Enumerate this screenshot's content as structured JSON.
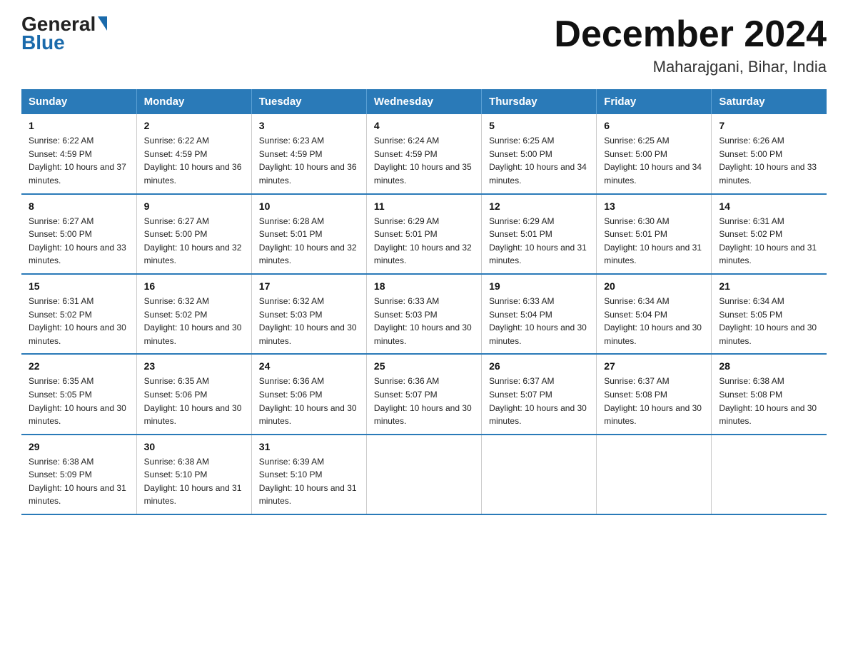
{
  "header": {
    "logo_general": "General",
    "logo_blue": "Blue",
    "month_title": "December 2024",
    "location": "Maharajgani, Bihar, India"
  },
  "days_of_week": [
    "Sunday",
    "Monday",
    "Tuesday",
    "Wednesday",
    "Thursday",
    "Friday",
    "Saturday"
  ],
  "weeks": [
    [
      {
        "day": "1",
        "sunrise": "6:22 AM",
        "sunset": "4:59 PM",
        "daylight": "10 hours and 37 minutes."
      },
      {
        "day": "2",
        "sunrise": "6:22 AM",
        "sunset": "4:59 PM",
        "daylight": "10 hours and 36 minutes."
      },
      {
        "day": "3",
        "sunrise": "6:23 AM",
        "sunset": "4:59 PM",
        "daylight": "10 hours and 36 minutes."
      },
      {
        "day": "4",
        "sunrise": "6:24 AM",
        "sunset": "4:59 PM",
        "daylight": "10 hours and 35 minutes."
      },
      {
        "day": "5",
        "sunrise": "6:25 AM",
        "sunset": "5:00 PM",
        "daylight": "10 hours and 34 minutes."
      },
      {
        "day": "6",
        "sunrise": "6:25 AM",
        "sunset": "5:00 PM",
        "daylight": "10 hours and 34 minutes."
      },
      {
        "day": "7",
        "sunrise": "6:26 AM",
        "sunset": "5:00 PM",
        "daylight": "10 hours and 33 minutes."
      }
    ],
    [
      {
        "day": "8",
        "sunrise": "6:27 AM",
        "sunset": "5:00 PM",
        "daylight": "10 hours and 33 minutes."
      },
      {
        "day": "9",
        "sunrise": "6:27 AM",
        "sunset": "5:00 PM",
        "daylight": "10 hours and 32 minutes."
      },
      {
        "day": "10",
        "sunrise": "6:28 AM",
        "sunset": "5:01 PM",
        "daylight": "10 hours and 32 minutes."
      },
      {
        "day": "11",
        "sunrise": "6:29 AM",
        "sunset": "5:01 PM",
        "daylight": "10 hours and 32 minutes."
      },
      {
        "day": "12",
        "sunrise": "6:29 AM",
        "sunset": "5:01 PM",
        "daylight": "10 hours and 31 minutes."
      },
      {
        "day": "13",
        "sunrise": "6:30 AM",
        "sunset": "5:01 PM",
        "daylight": "10 hours and 31 minutes."
      },
      {
        "day": "14",
        "sunrise": "6:31 AM",
        "sunset": "5:02 PM",
        "daylight": "10 hours and 31 minutes."
      }
    ],
    [
      {
        "day": "15",
        "sunrise": "6:31 AM",
        "sunset": "5:02 PM",
        "daylight": "10 hours and 30 minutes."
      },
      {
        "day": "16",
        "sunrise": "6:32 AM",
        "sunset": "5:02 PM",
        "daylight": "10 hours and 30 minutes."
      },
      {
        "day": "17",
        "sunrise": "6:32 AM",
        "sunset": "5:03 PM",
        "daylight": "10 hours and 30 minutes."
      },
      {
        "day": "18",
        "sunrise": "6:33 AM",
        "sunset": "5:03 PM",
        "daylight": "10 hours and 30 minutes."
      },
      {
        "day": "19",
        "sunrise": "6:33 AM",
        "sunset": "5:04 PM",
        "daylight": "10 hours and 30 minutes."
      },
      {
        "day": "20",
        "sunrise": "6:34 AM",
        "sunset": "5:04 PM",
        "daylight": "10 hours and 30 minutes."
      },
      {
        "day": "21",
        "sunrise": "6:34 AM",
        "sunset": "5:05 PM",
        "daylight": "10 hours and 30 minutes."
      }
    ],
    [
      {
        "day": "22",
        "sunrise": "6:35 AM",
        "sunset": "5:05 PM",
        "daylight": "10 hours and 30 minutes."
      },
      {
        "day": "23",
        "sunrise": "6:35 AM",
        "sunset": "5:06 PM",
        "daylight": "10 hours and 30 minutes."
      },
      {
        "day": "24",
        "sunrise": "6:36 AM",
        "sunset": "5:06 PM",
        "daylight": "10 hours and 30 minutes."
      },
      {
        "day": "25",
        "sunrise": "6:36 AM",
        "sunset": "5:07 PM",
        "daylight": "10 hours and 30 minutes."
      },
      {
        "day": "26",
        "sunrise": "6:37 AM",
        "sunset": "5:07 PM",
        "daylight": "10 hours and 30 minutes."
      },
      {
        "day": "27",
        "sunrise": "6:37 AM",
        "sunset": "5:08 PM",
        "daylight": "10 hours and 30 minutes."
      },
      {
        "day": "28",
        "sunrise": "6:38 AM",
        "sunset": "5:08 PM",
        "daylight": "10 hours and 30 minutes."
      }
    ],
    [
      {
        "day": "29",
        "sunrise": "6:38 AM",
        "sunset": "5:09 PM",
        "daylight": "10 hours and 31 minutes."
      },
      {
        "day": "30",
        "sunrise": "6:38 AM",
        "sunset": "5:10 PM",
        "daylight": "10 hours and 31 minutes."
      },
      {
        "day": "31",
        "sunrise": "6:39 AM",
        "sunset": "5:10 PM",
        "daylight": "10 hours and 31 minutes."
      },
      null,
      null,
      null,
      null
    ]
  ],
  "labels": {
    "sunrise_prefix": "Sunrise: ",
    "sunset_prefix": "Sunset: ",
    "daylight_prefix": "Daylight: "
  }
}
